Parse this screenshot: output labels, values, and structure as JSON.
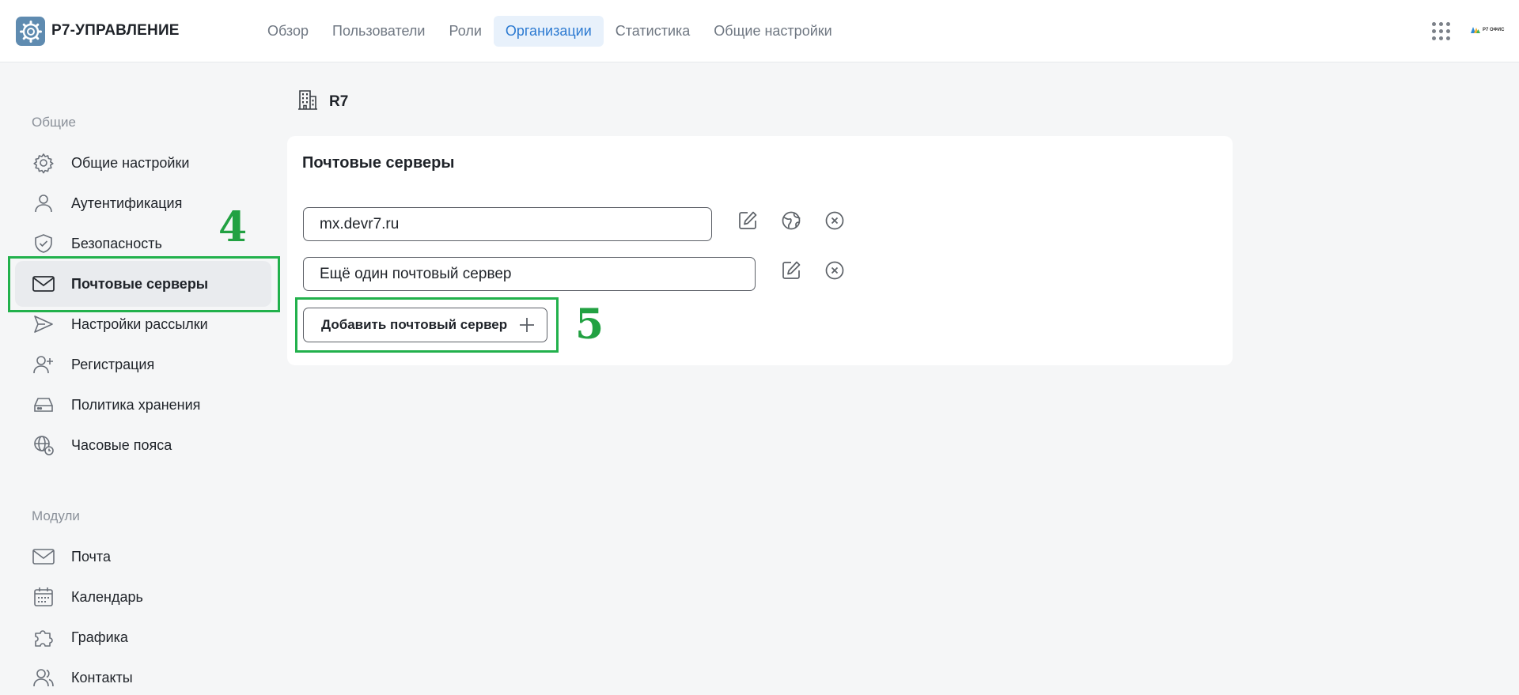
{
  "header": {
    "brand": "Р7-УПРАВЛЕНИЕ",
    "nav": [
      {
        "label": "Обзор",
        "active": false
      },
      {
        "label": "Пользователи",
        "active": false
      },
      {
        "label": "Роли",
        "active": false
      },
      {
        "label": "Организации",
        "active": true
      },
      {
        "label": "Статистика",
        "active": false
      },
      {
        "label": "Общие настройки",
        "active": false
      }
    ],
    "vendor_logo_text": "Р7 ОФИС"
  },
  "sidebar": {
    "general_title": "Общие",
    "general_items": [
      {
        "label": "Общие настройки",
        "icon": "gear-icon"
      },
      {
        "label": "Аутентификация",
        "icon": "user-icon"
      },
      {
        "label": "Безопасность",
        "icon": "shield-icon"
      },
      {
        "label": "Почтовые серверы",
        "icon": "envelope-icon",
        "active": true
      },
      {
        "label": "Настройки рассылки",
        "icon": "send-icon"
      },
      {
        "label": "Регистрация",
        "icon": "user-plus-icon"
      },
      {
        "label": "Политика хранения",
        "icon": "storage-icon"
      },
      {
        "label": "Часовые пояса",
        "icon": "globe-clock-icon"
      }
    ],
    "modules_title": "Модули",
    "module_items": [
      {
        "label": "Почта",
        "icon": "envelope-icon"
      },
      {
        "label": "Календарь",
        "icon": "calendar-icon"
      },
      {
        "label": "Графика",
        "icon": "puzzle-icon"
      },
      {
        "label": "Контакты",
        "icon": "contacts-icon"
      }
    ]
  },
  "main": {
    "org_name": "R7",
    "card_title": "Почтовые серверы",
    "servers": [
      {
        "value": "mx.devr7.ru"
      },
      {
        "value": "Ещё один почтовый сервер"
      }
    ],
    "add_button_label": "Добавить почтовый сервер"
  },
  "annotations": {
    "marker_4": "4",
    "marker_5": "5",
    "color": "#22b14c"
  },
  "colors": {
    "accent": "#2c7ad1",
    "active_nav_bg": "#e8f1fb",
    "logo_bg": "#5f8bb0"
  }
}
